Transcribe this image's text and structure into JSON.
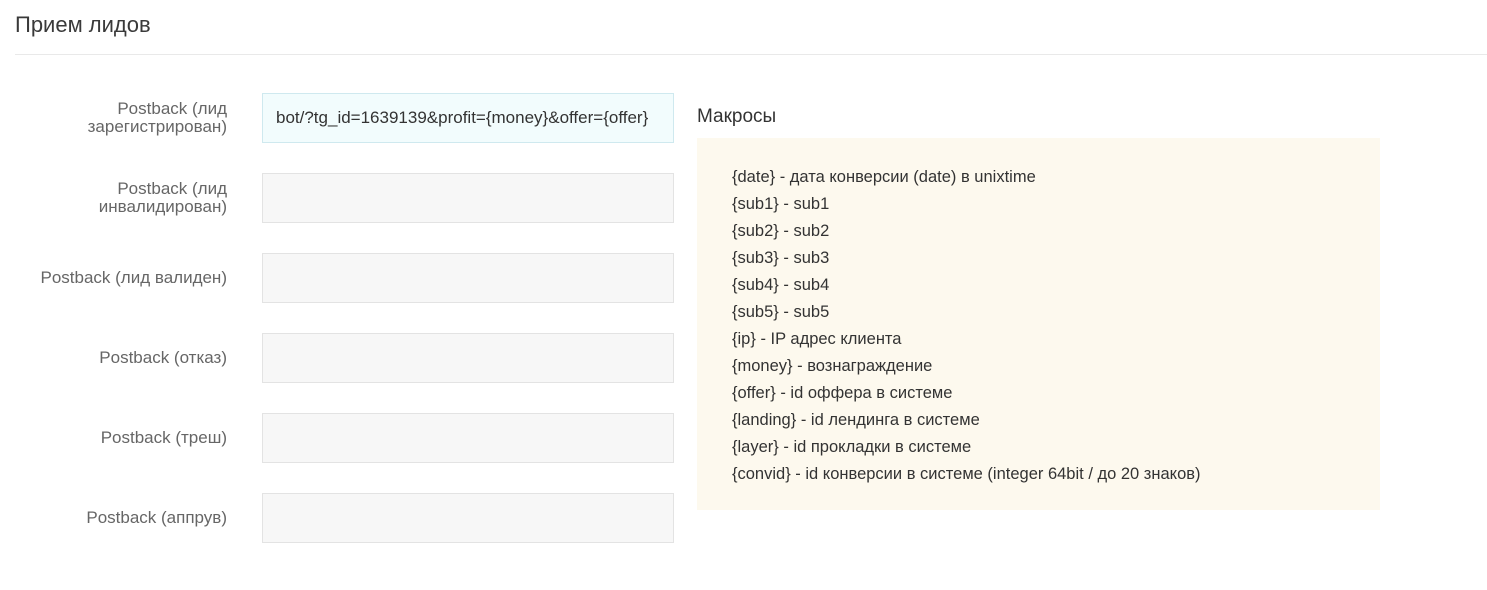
{
  "page": {
    "title": "Прием лидов"
  },
  "postback_rows": [
    {
      "label": "Postback (лид зарегистрирован)",
      "value": "bot/?tg_id=1639139&profit={money}&offer={offer}",
      "placeholder": ""
    },
    {
      "label": "Postback (лид инвалидирован)",
      "value": "",
      "placeholder": ""
    },
    {
      "label": "Postback (лид валиден)",
      "value": "",
      "placeholder": ""
    },
    {
      "label": "Postback (отказ)",
      "value": "",
      "placeholder": ""
    },
    {
      "label": "Postback (треш)",
      "value": "",
      "placeholder": ""
    },
    {
      "label": "Postback (аппрув)",
      "value": "",
      "placeholder": ""
    }
  ],
  "macros": {
    "title": "Макросы",
    "items": [
      "{date} - дата конверсии (date) в unixtime",
      "{sub1} - sub1",
      "{sub2} - sub2",
      "{sub3} - sub3",
      "{sub4} - sub4",
      "{sub5} - sub5",
      "{ip} - IP адрес клиента",
      "{money} - вознаграждение",
      "{offer} - id оффера в системе",
      "{landing} - id лендинга в системе",
      "{layer} - id прокладки в системе",
      "{convid} - id конверсии в системе (integer 64bit / до 20 знаков)"
    ]
  }
}
